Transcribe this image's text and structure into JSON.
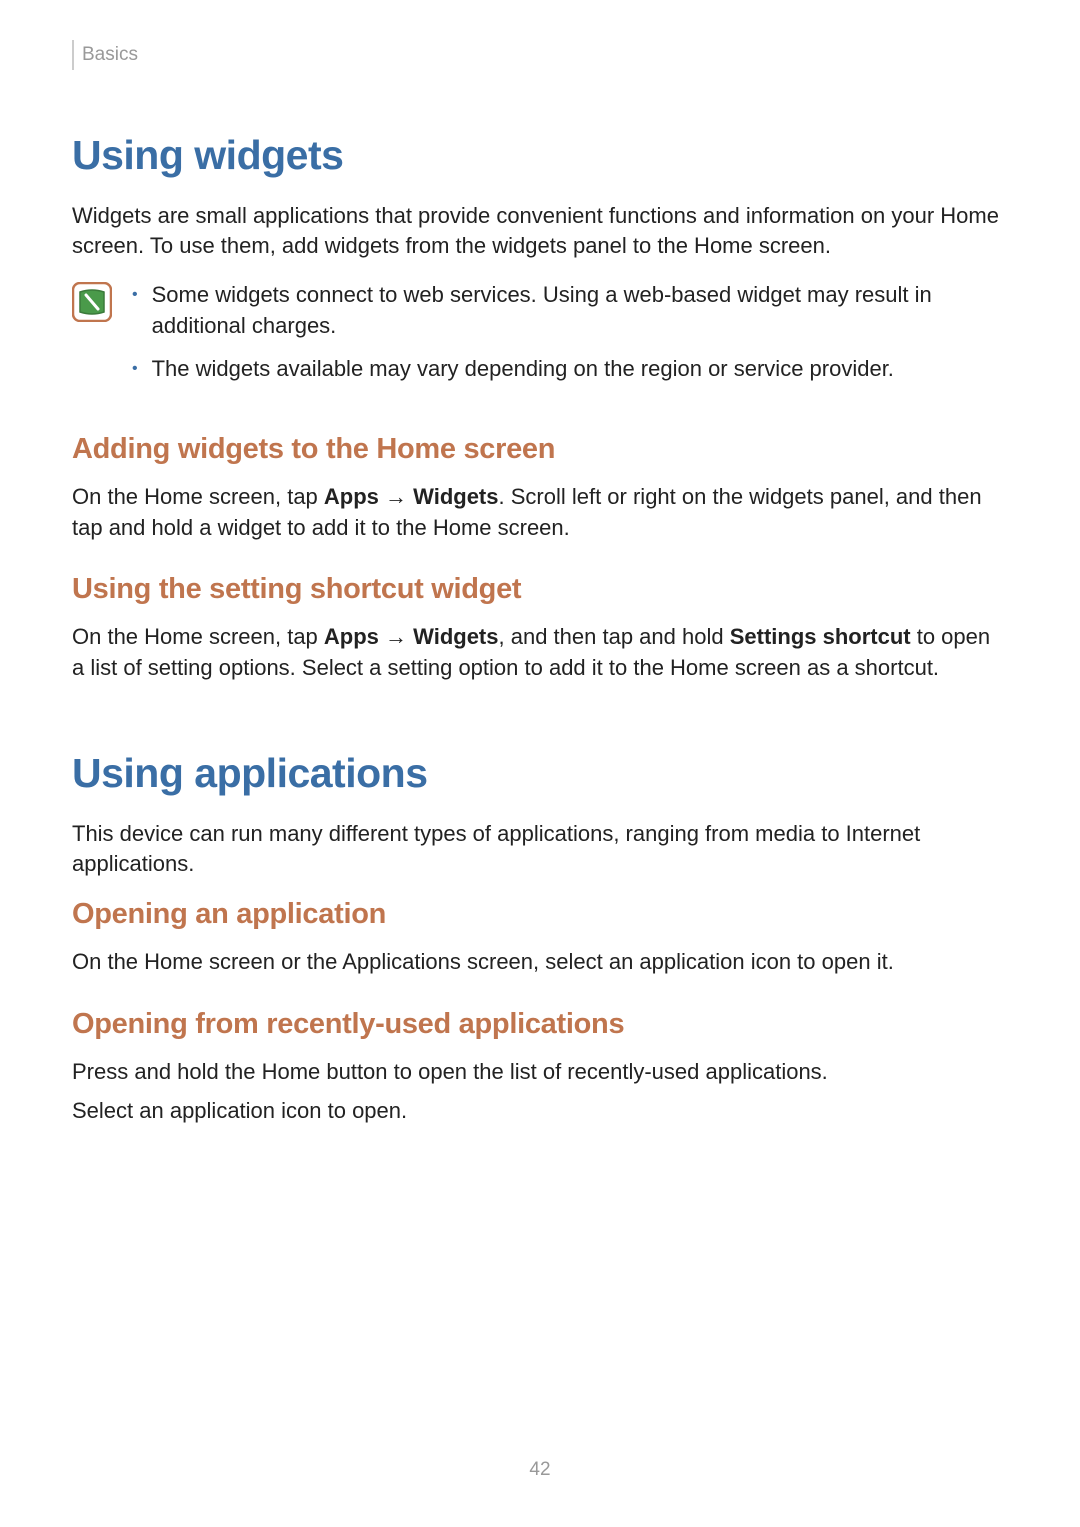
{
  "breadcrumb": "Basics",
  "section1": {
    "title": "Using widgets",
    "intro": "Widgets are small applications that provide convenient functions and information on your Home screen. To use them, add widgets from the widgets panel to the Home screen.",
    "notes": [
      "Some widgets connect to web services. Using a web-based widget may result in additional charges.",
      "The widgets available may vary depending on the region or service provider."
    ],
    "sub1": {
      "title": "Adding widgets to the Home screen",
      "pre": "On the Home screen, tap ",
      "bold1": "Apps",
      "arrow": " → ",
      "bold2": "Widgets",
      "post": ". Scroll left or right on the widgets panel, and then tap and hold a widget to add it to the Home screen."
    },
    "sub2": {
      "title": "Using the setting shortcut widget",
      "pre": "On the Home screen, tap ",
      "bold1": "Apps",
      "arrow": " → ",
      "bold2": "Widgets",
      "mid": ", and then tap and hold ",
      "bold3": "Settings shortcut",
      "post": " to open a list of setting options. Select a setting option to add it to the Home screen as a shortcut."
    }
  },
  "section2": {
    "title": "Using applications",
    "intro": "This device can run many different types of applications, ranging from media to Internet applications.",
    "sub1": {
      "title": "Opening an application",
      "body": "On the Home screen or the Applications screen, select an application icon to open it."
    },
    "sub2": {
      "title": "Opening from recently-used applications",
      "line1": "Press and hold the Home button to open the list of recently-used applications.",
      "line2": "Select an application icon to open."
    }
  },
  "page_number": "42"
}
